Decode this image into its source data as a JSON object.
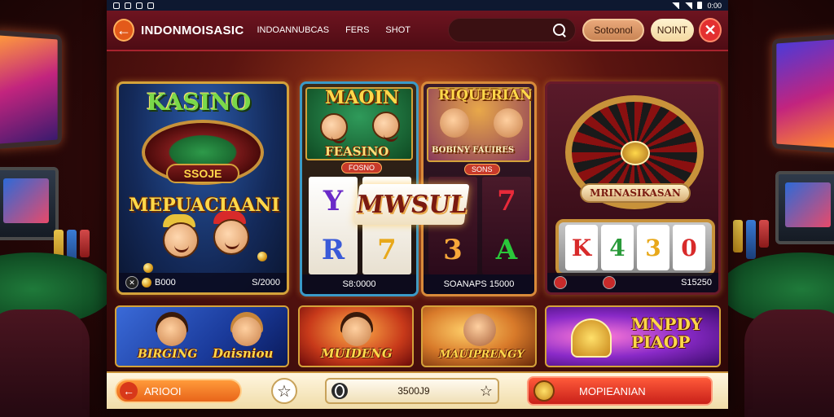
{
  "status": {
    "time": "0:00"
  },
  "header": {
    "brand": "INDONMOISASIC",
    "nav": [
      "INDOANNUBCAS",
      "FERS",
      "SHOT"
    ],
    "search_placeholder": "",
    "secondary_button": "Sotoonol",
    "primary_button": "NOINT"
  },
  "cards": {
    "kasino": {
      "title": "KASINO",
      "plate": "SSOJE",
      "subtitle": "MEPUACIAANI",
      "foot_left": "B000",
      "foot_right": "S/2000"
    },
    "maoin": {
      "title": "MAOIN",
      "sign": "FEASINO",
      "chip": "FOSNO",
      "reels": [
        "Y",
        "R",
        "7",
        "7"
      ],
      "foot": "S8:0000"
    },
    "riquerian": {
      "title": "RIQUERIAN",
      "sign": "BOBINY FAUIRES",
      "chip": "SONS",
      "reels": [
        "7",
        "3",
        "7",
        "A"
      ],
      "foot": "SOANAPS 15000"
    },
    "roulette": {
      "plaque": "MRINASIKASAN",
      "slots": [
        "K",
        "4",
        "3",
        "0"
      ],
      "foot": "S15250"
    },
    "banner_overlay": "MWSUL"
  },
  "promos": [
    {
      "title": "BIRGING",
      "title2": "Daisniou"
    },
    {
      "title": "MUIDENG"
    },
    {
      "title": "MAUIPRENGY"
    },
    {
      "title": "MNPDY PIAOP"
    }
  ],
  "bottom_bar": {
    "left_label": "ARIOOI",
    "amount": "3500J9",
    "cta": "MOPIEANIAN"
  },
  "colors": {
    "accent": "#d4a23a",
    "cta": "#c8201a",
    "header": "#6e1420"
  }
}
